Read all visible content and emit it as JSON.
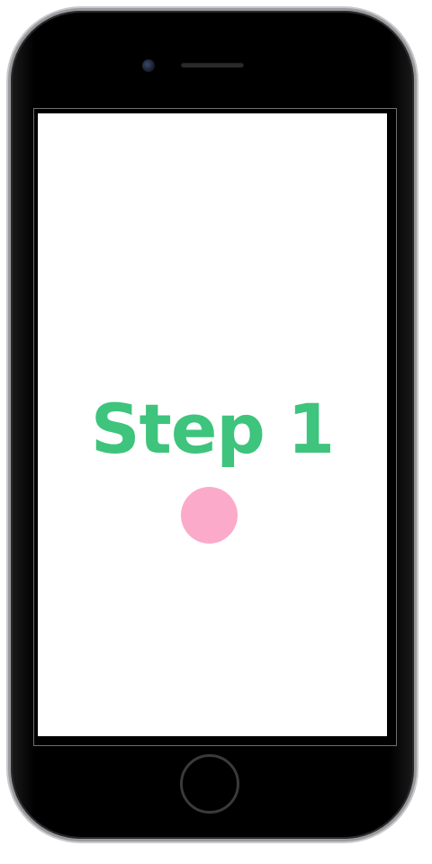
{
  "screen": {
    "title": "Step 1",
    "title_color": "#3ec47c",
    "dot_color": "#fcaac9"
  },
  "device": {
    "body_color": "#000000",
    "bezel_color": "#9a9a9e",
    "icons": [
      "front-camera-icon",
      "earpiece-speaker-icon",
      "home-button-icon"
    ]
  }
}
